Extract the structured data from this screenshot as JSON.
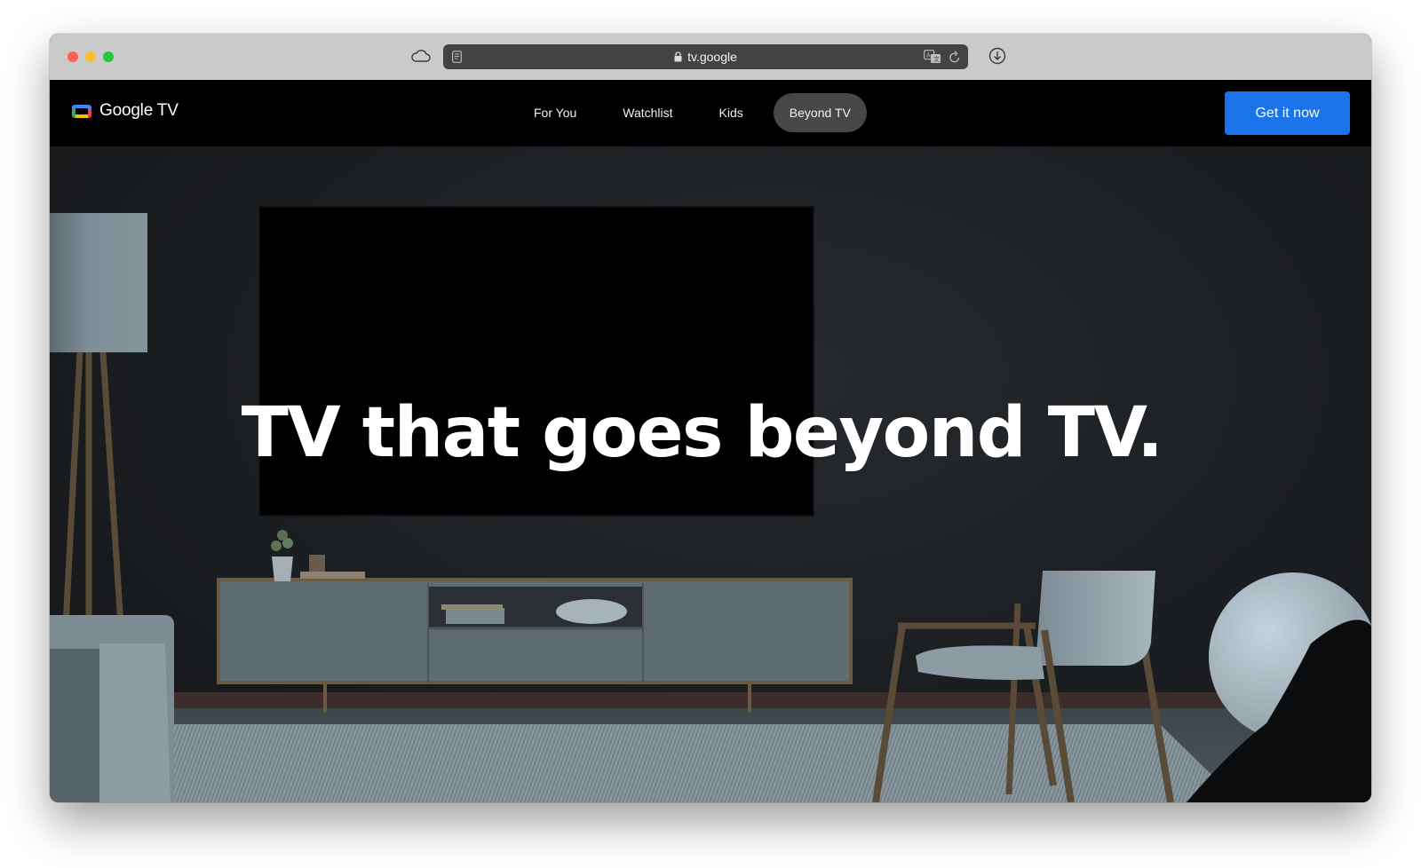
{
  "browser": {
    "url": "tv.google",
    "icons": [
      "cloud-icon",
      "reader-icon",
      "lock-icon",
      "translate-icon",
      "reload-icon",
      "download-icon"
    ]
  },
  "header": {
    "logo_text": "Google TV",
    "logo_colors": {
      "blue": "#4285f4",
      "red": "#ea4335",
      "yellow": "#fbbc04",
      "green": "#34a853"
    },
    "nav": [
      {
        "label": "For You",
        "active": false
      },
      {
        "label": "Watchlist",
        "active": false
      },
      {
        "label": "Kids",
        "active": false
      },
      {
        "label": "Beyond TV",
        "active": true
      }
    ],
    "cta_label": "Get it now",
    "cta_color": "#1a73e8"
  },
  "hero": {
    "headline": "TV that goes beyond TV."
  }
}
